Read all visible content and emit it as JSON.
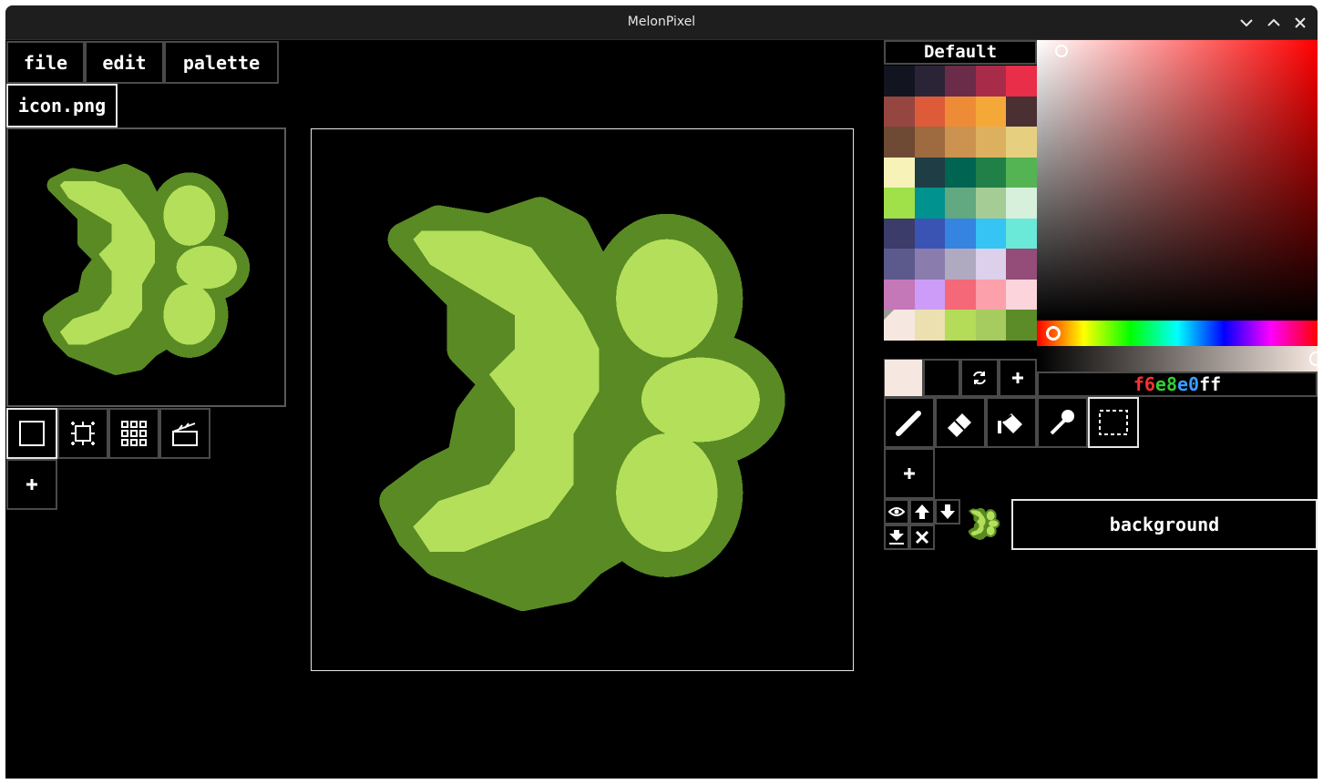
{
  "window": {
    "title": "MelonPixel",
    "controls": [
      "chevron-down-icon",
      "chevron-up-icon",
      "close-icon"
    ]
  },
  "menu": {
    "file_label": "file",
    "edit_label": "edit",
    "palette_label": "palette"
  },
  "tabs": [
    {
      "label": "icon.png",
      "active": true
    }
  ],
  "frame_tools": [
    {
      "icon": "square-icon",
      "active": true
    },
    {
      "icon": "selection-frame-icon",
      "active": false
    },
    {
      "icon": "grid-icon",
      "active": false
    },
    {
      "icon": "clapperboard-icon",
      "active": false
    }
  ],
  "add_frame_icon": "plus-icon",
  "palette": {
    "name": "Default",
    "colors": [
      "#121420",
      "#2b2436",
      "#6a2c48",
      "#a82c4a",
      "#e82e48",
      "#964640",
      "#de5b3a",
      "#ee8b36",
      "#f4a838",
      "#4a2f33",
      "#6e4a34",
      "#9e6a40",
      "#cc9250",
      "#dcb05e",
      "#e6d080",
      "#f6f2b8",
      "#1f3d44",
      "#006452",
      "#208048",
      "#54b454",
      "#a0e048",
      "#00928e",
      "#62a880",
      "#a6cc96",
      "#d6f0dc",
      "#3c3c6a",
      "#3a54b4",
      "#3484e0",
      "#36c4f4",
      "#6ae8d8",
      "#5c5a8c",
      "#8a7cac",
      "#b0aac0",
      "#dcd0ec",
      "#944c78",
      "#c478b8",
      "#cc9cf8",
      "#f46878",
      "#fca0aa",
      "#fcd4dc",
      "#f6e8e0",
      "#ece0b0",
      "#b4dc58",
      "#a6cc60",
      "#5c8c28"
    ],
    "transparent_index": 40
  },
  "color": {
    "primary": "#f6e8e0",
    "secondary": "#000000",
    "hex": {
      "r": "f6",
      "g": "e8",
      "b": "e0",
      "a": "ff"
    },
    "hex_colors": {
      "r": "#ff3030",
      "g": "#30d030",
      "b": "#3a9cff",
      "a": "#ffffff"
    }
  },
  "tools": [
    {
      "icon": "pencil-icon",
      "active": false
    },
    {
      "icon": "eraser-icon",
      "active": false
    },
    {
      "icon": "paint-bucket-icon",
      "active": false
    },
    {
      "icon": "eyedropper-icon",
      "active": false
    },
    {
      "icon": "selection-icon",
      "active": true
    }
  ],
  "layers": [
    {
      "name": "background",
      "visible": true,
      "selected": true
    }
  ],
  "sprite": {
    "dark": "#5a8a24",
    "light": "#b3df5a"
  }
}
